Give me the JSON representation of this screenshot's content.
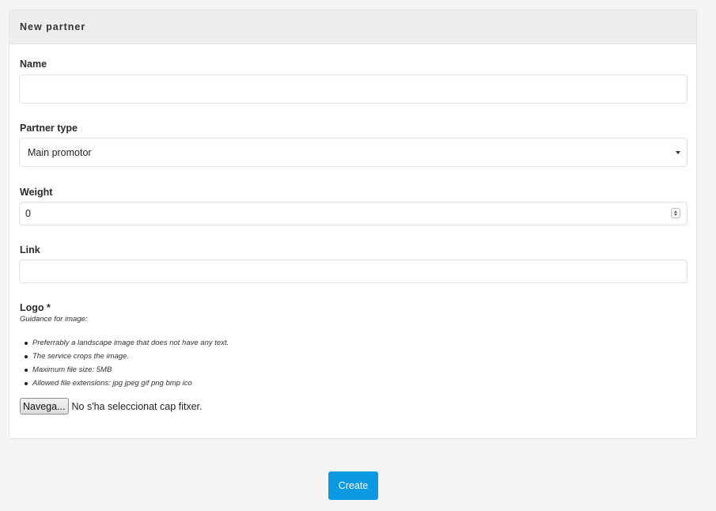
{
  "card": {
    "title": "New partner"
  },
  "form": {
    "name": {
      "label": "Name",
      "value": ""
    },
    "partner_type": {
      "label": "Partner type",
      "selected": "Main promotor"
    },
    "weight": {
      "label": "Weight",
      "value": "0"
    },
    "link": {
      "label": "Link",
      "value": ""
    },
    "logo": {
      "label": "Logo *",
      "guidance_title": "Guidance for image:",
      "guidance_items": [
        "Preferrably a landscape image that does not have any text.",
        "The service crops the image.",
        "Maximum file size: 5MB",
        "Allowed file extensions: jpg jpeg gif png bmp ico"
      ],
      "browse_label": "Navega...",
      "file_status": "No s'ha seleccionat cap fitxer."
    }
  },
  "actions": {
    "create_label": "Create"
  },
  "colors": {
    "primary_button": "#0b9ae2",
    "background": "#f4f4f4",
    "card_header": "#eeeeee"
  }
}
